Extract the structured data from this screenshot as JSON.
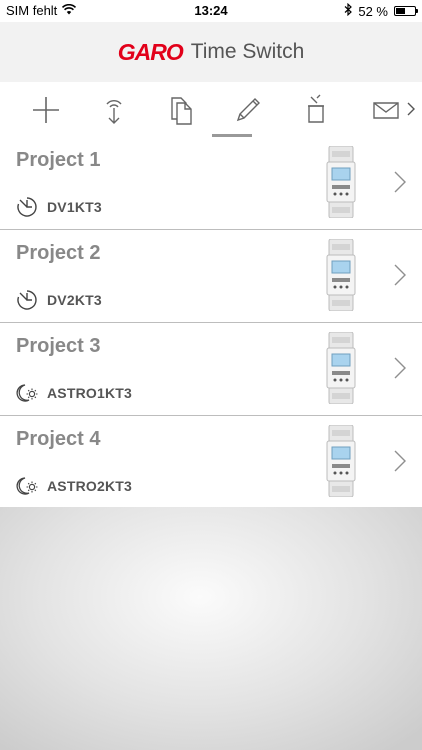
{
  "status_bar": {
    "carrier": "SIM fehlt",
    "time": "13:24",
    "battery_percent": "52 %",
    "battery_level": 0.52
  },
  "header": {
    "logo": "GARO",
    "title": "Time Switch"
  },
  "toolbar": {
    "active_index": 3,
    "tools": [
      "add-icon",
      "receive-icon",
      "copy-icon",
      "edit-icon",
      "delete-icon",
      "mail-icon"
    ]
  },
  "projects": [
    {
      "name": "Project 1",
      "model": "DV1KT3",
      "type_icon": "timer-clock-icon"
    },
    {
      "name": "Project 2",
      "model": "DV2KT3",
      "type_icon": "timer-clock-icon"
    },
    {
      "name": "Project 3",
      "model": "ASTRO1KT3",
      "type_icon": "astro-moon-sun-icon"
    },
    {
      "name": "Project 4",
      "model": "ASTRO2KT3",
      "type_icon": "astro-moon-sun-icon"
    }
  ],
  "colors": {
    "brand_red": "#e2001a",
    "title_gray": "#888888",
    "model_gray": "#555555"
  }
}
